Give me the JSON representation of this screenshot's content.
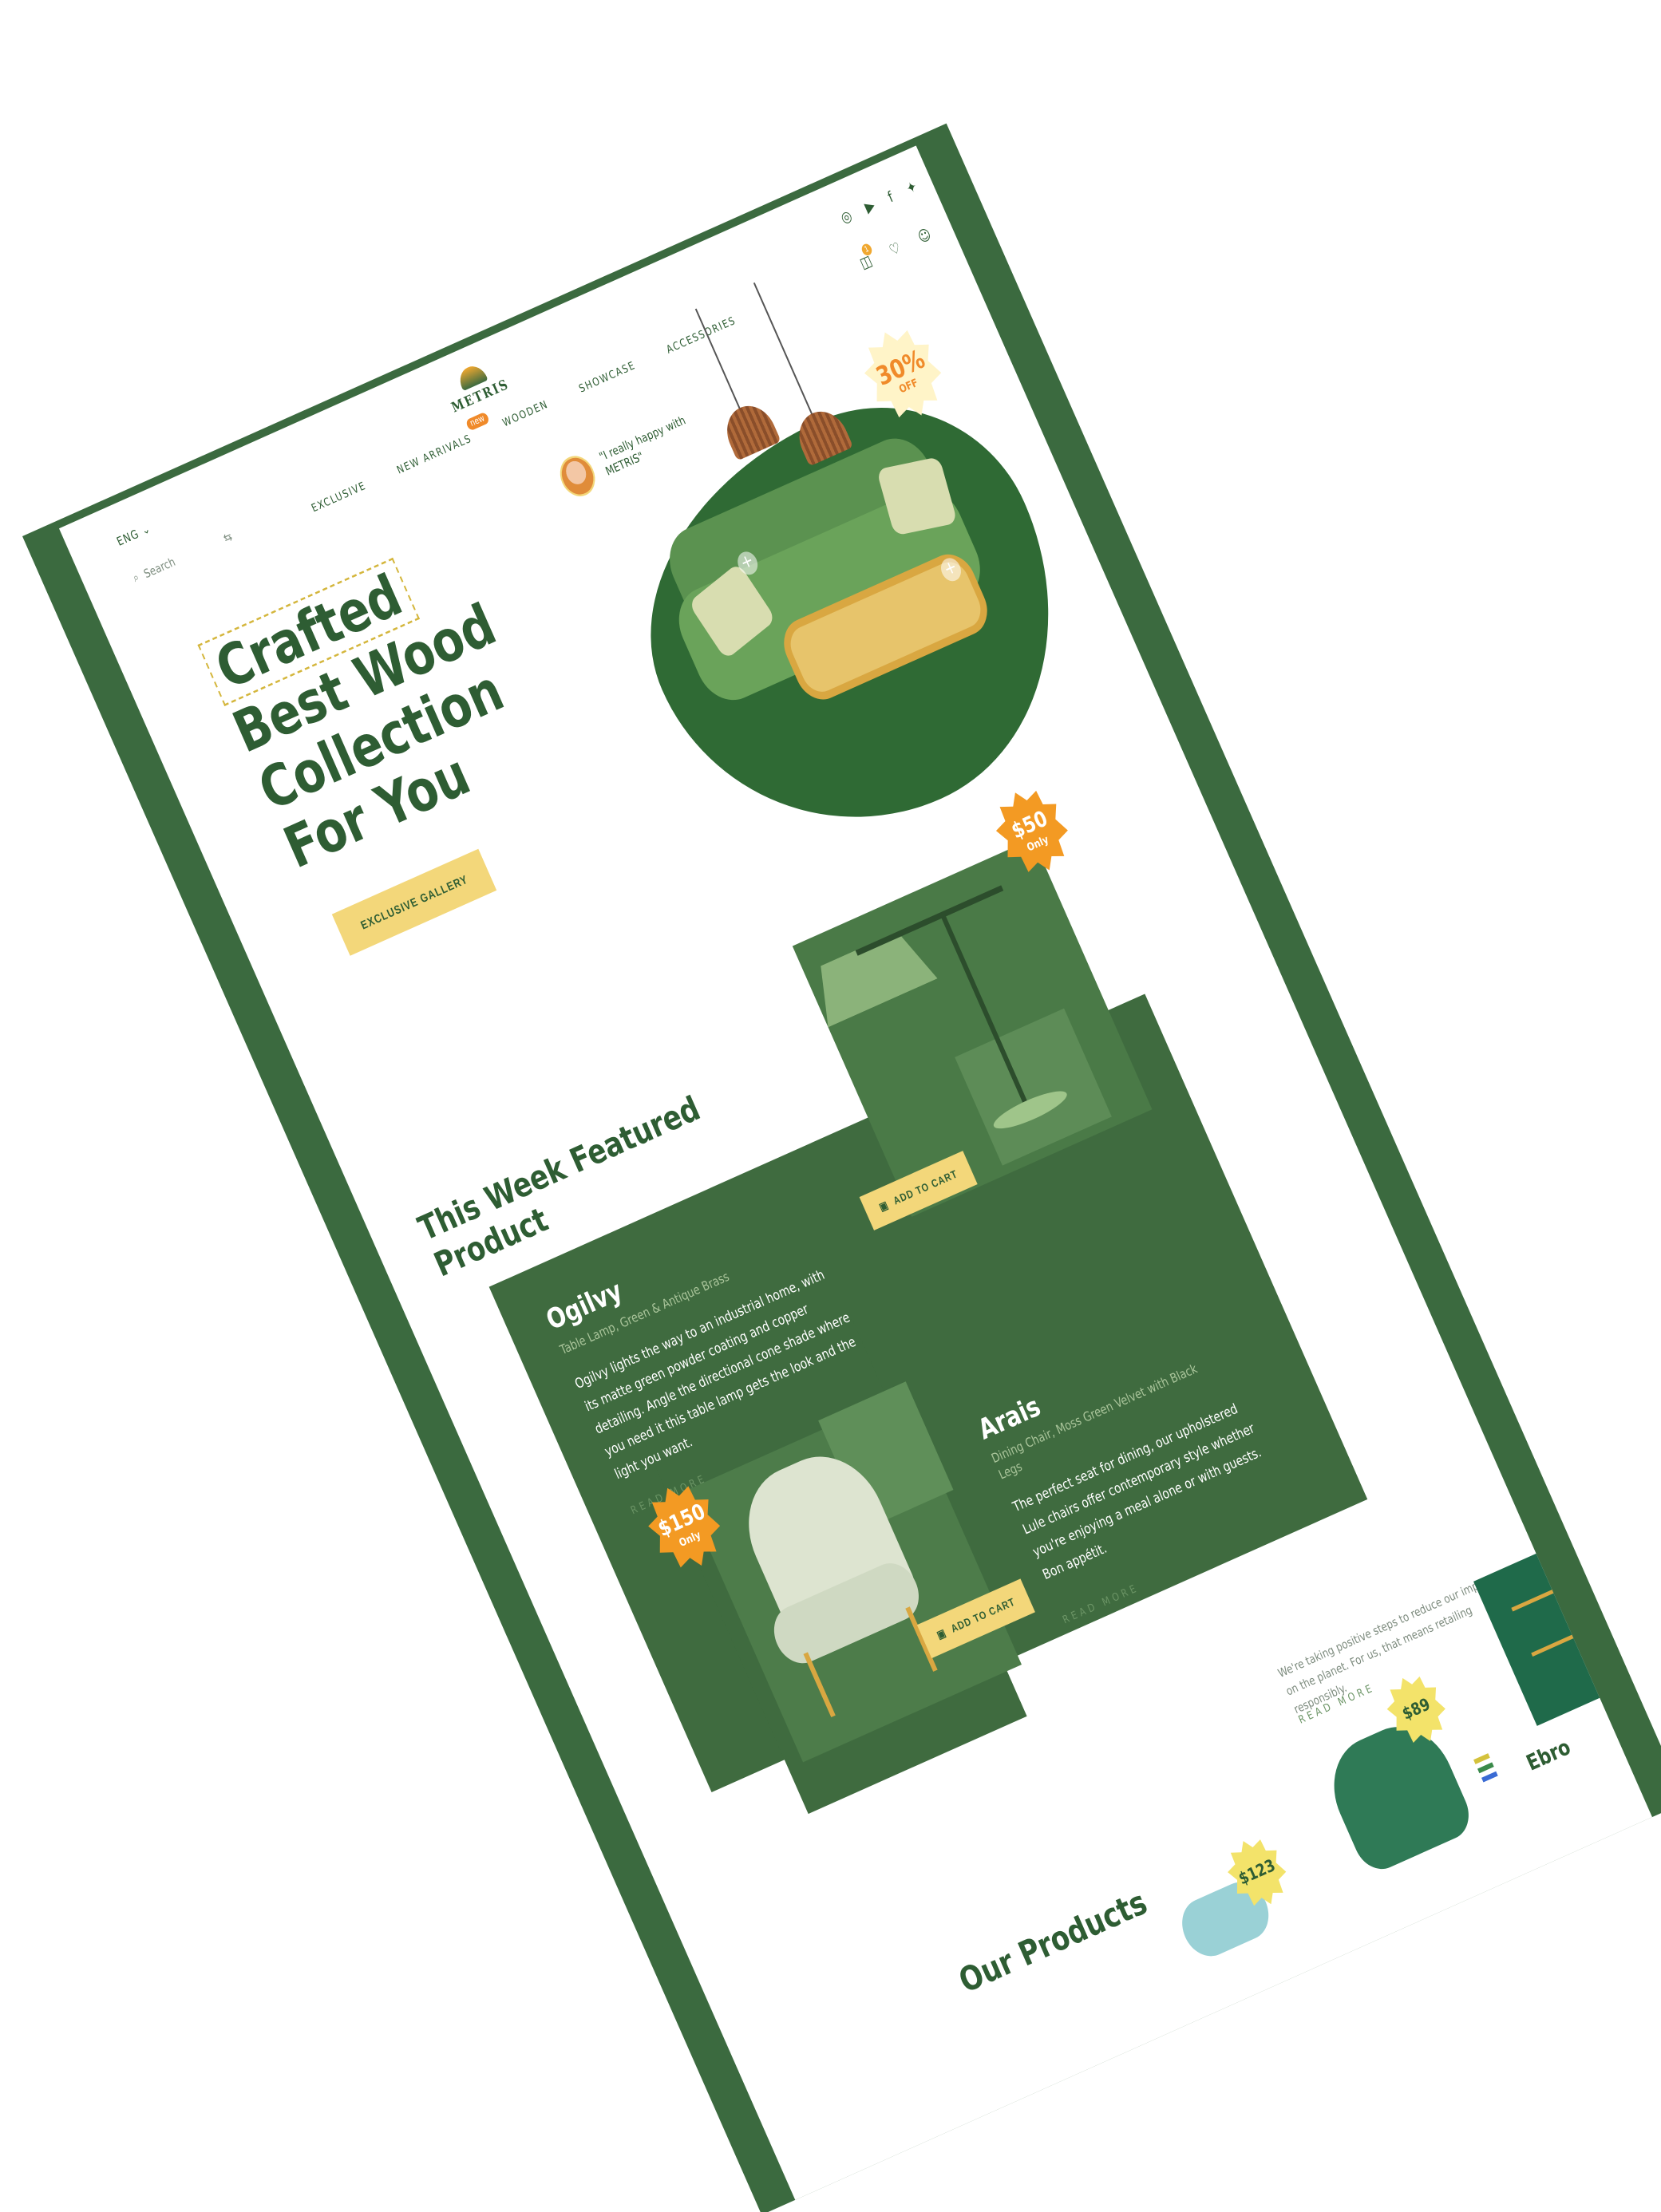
{
  "header": {
    "social_icons": [
      "instagram-icon",
      "youtube-icon",
      "facebook-icon",
      "twitter-icon"
    ],
    "language": "ENG",
    "search_placeholder": "Search",
    "brand": "METRIS",
    "nav": [
      {
        "label": "EXCLUSIVE",
        "badge": ""
      },
      {
        "label": "NEW ARRIVALS",
        "badge": "new"
      },
      {
        "label": "WOODEN",
        "badge": ""
      },
      {
        "label": "SHOWCASE",
        "badge": ""
      },
      {
        "label": "ACCESSORIES",
        "badge": ""
      }
    ],
    "cart_count": "1"
  },
  "hero": {
    "title_boxed": "Crafted",
    "title_rest": [
      "Best Wood",
      "Collection",
      "For You"
    ],
    "cta": "EXCLUSIVE GALLERY",
    "quote": "\"I really happy with METRIS\"",
    "discount_value": "30%",
    "discount_label": "OFF"
  },
  "featured": {
    "title_line1": "This Week Featured",
    "title_line2": "Product",
    "products": [
      {
        "name": "Ogilvy",
        "subtitle": "Table Lamp, Green & Antique Brass",
        "description": "Ogilvy lights the way to an industrial home, with its matte green powder coating and copper detailing. Angle the directional cone shade where you need it this table lamp gets the look and the light you want.",
        "read_more": "READ MORE",
        "cart": "ADD TO CART",
        "price": "$50",
        "price_note": "Only"
      },
      {
        "name": "Arais",
        "subtitle": "Dining Chair, Moss Green Velvet with Black Legs",
        "description": "The perfect seat for dining, our upholstered Lule chairs offer contemporary style whether you're enjoying a meal alone or with guests. Bon appétit.",
        "read_more": "READ MORE",
        "cart": "ADD TO CART",
        "price": "$150",
        "price_note": "Only"
      }
    ]
  },
  "our_products": {
    "title": "Our Products",
    "tagline": "We're taking positive steps to reduce our impact on the planet. For us, that means retailing responsibly.",
    "read_more": "READ MORE",
    "prices": [
      "$89",
      "$123"
    ],
    "next_product": "Ebro",
    "colors": {
      "brand_green": "#3b6a3f",
      "accent_yellow": "#f3d77a",
      "accent_orange": "#f39a23"
    }
  }
}
